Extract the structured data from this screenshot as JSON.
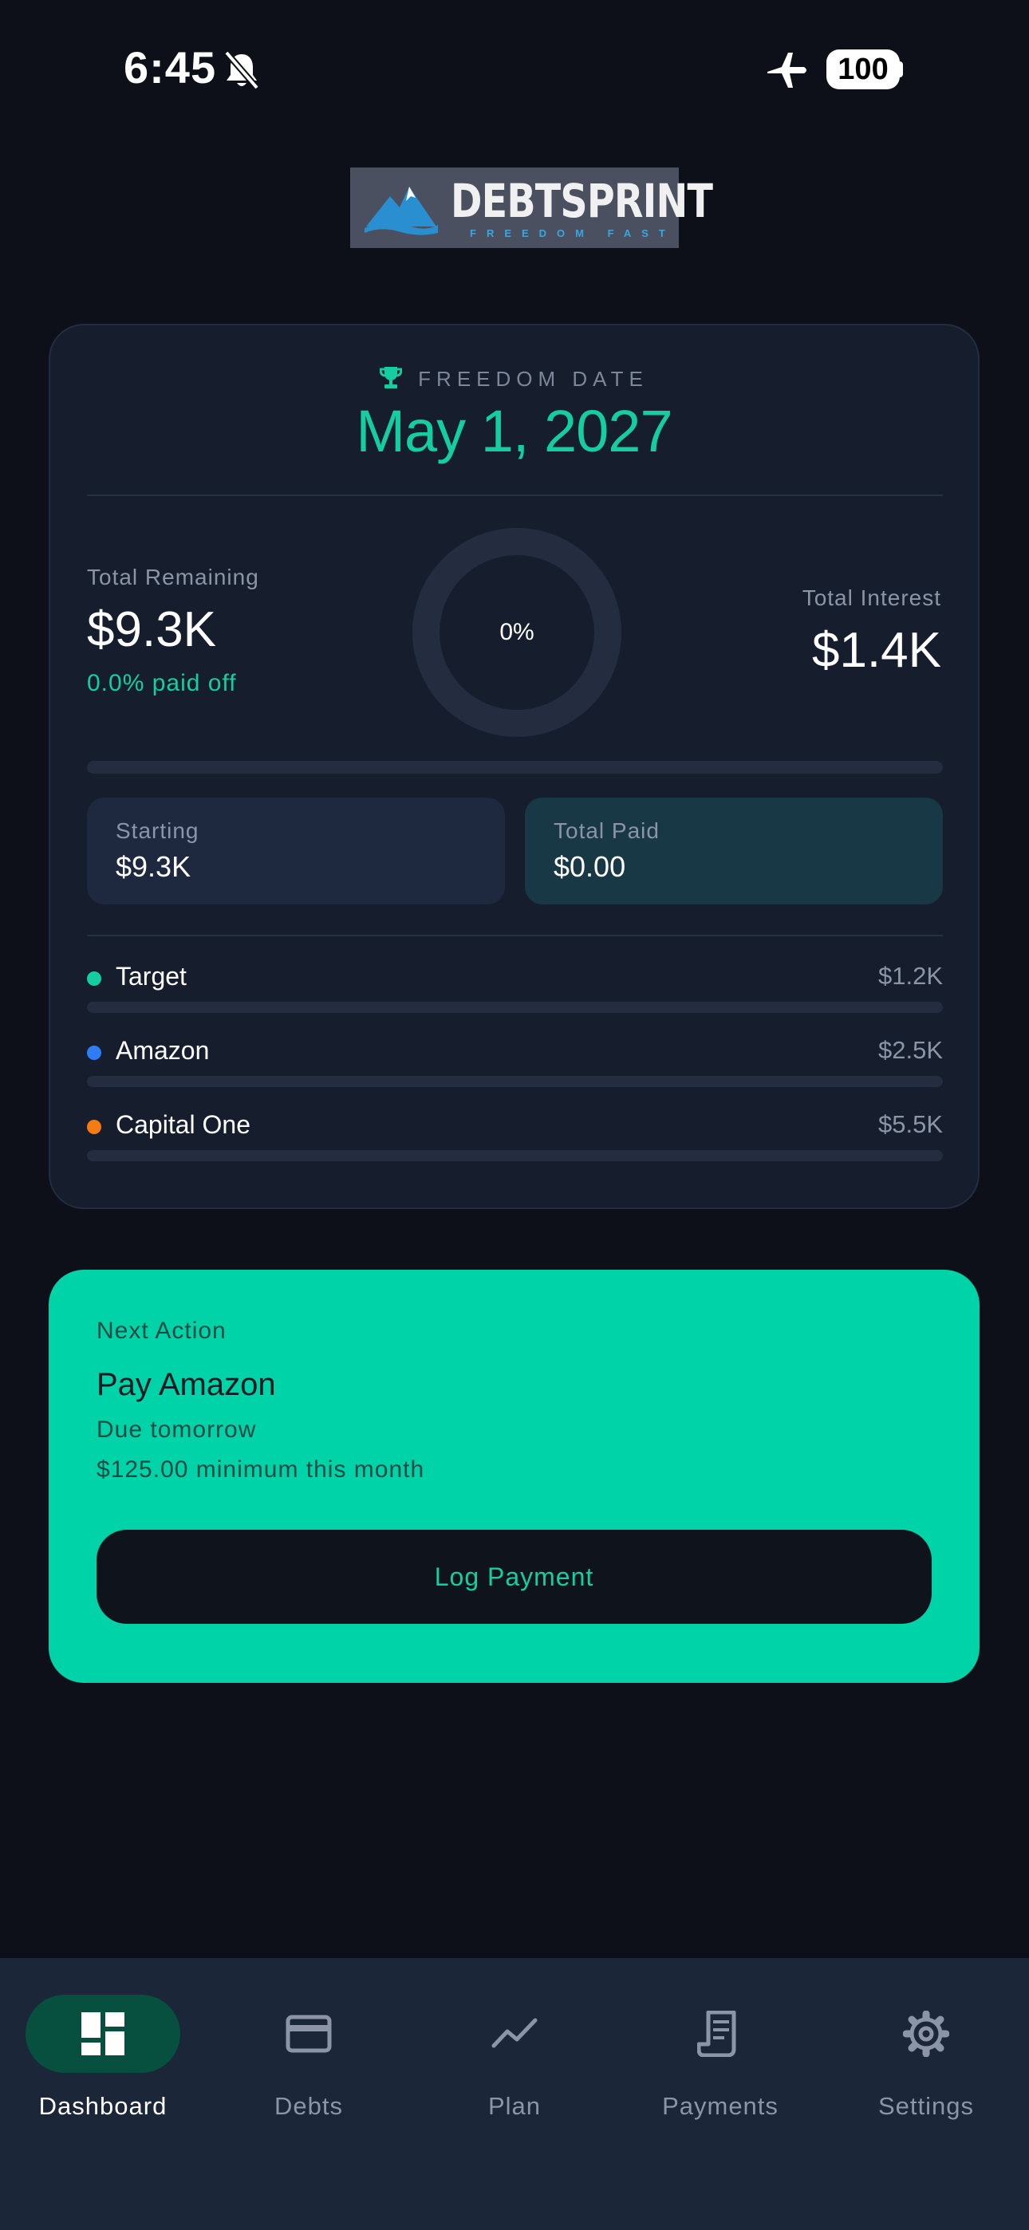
{
  "status_bar": {
    "time": "6:45",
    "battery": "100"
  },
  "logo": {
    "wordmark": "DEBTSPRINT",
    "tagline": "FREEDOM FAST"
  },
  "summary": {
    "freedom_label": "FREEDOM DATE",
    "freedom_date": "May 1, 2027",
    "total_remaining_label": "Total Remaining",
    "total_remaining_value": "$9.3K",
    "paid_off_text": "0.0% paid off",
    "progress_text": "0%",
    "progress_fraction": 0,
    "total_interest_label": "Total Interest",
    "total_interest_value": "$1.4K",
    "starting_label": "Starting",
    "starting_value": "$9.3K",
    "total_paid_label": "Total Paid",
    "total_paid_value": "$0.00"
  },
  "debts": [
    {
      "name": "Target",
      "amount": "$1.2K",
      "color": "#14cda1"
    },
    {
      "name": "Amazon",
      "amount": "$2.5K",
      "color": "#2f7df6"
    },
    {
      "name": "Capital One",
      "amount": "$5.5K",
      "color": "#f57c12"
    }
  ],
  "next_action": {
    "label": "Next Action",
    "title": "Pay Amazon",
    "due": "Due tomorrow",
    "minimum": "$125.00 minimum this month",
    "button": "Log Payment"
  },
  "nav": [
    {
      "label": "Dashboard",
      "icon": "dashboard-icon",
      "active": true
    },
    {
      "label": "Debts",
      "icon": "credit-card-icon",
      "active": false
    },
    {
      "label": "Plan",
      "icon": "trend-line-icon",
      "active": false
    },
    {
      "label": "Payments",
      "icon": "receipt-icon",
      "active": false
    },
    {
      "label": "Settings",
      "icon": "gear-icon",
      "active": false
    }
  ],
  "colors": {
    "accent": "#14cda1",
    "background": "#0d1018",
    "card": "#161e2e",
    "action_card": "#00d3a8"
  }
}
